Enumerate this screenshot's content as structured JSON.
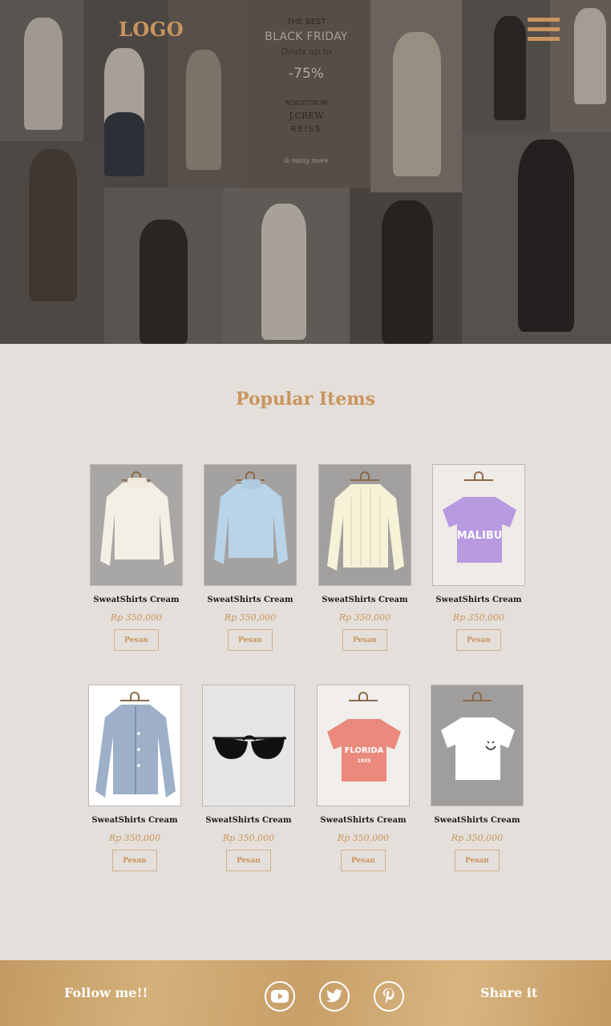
{
  "header": {
    "logo": "LOGO",
    "menu_icon": "hamburger-menu-icon"
  },
  "hero": {
    "promo": {
      "line1": "THE BEST",
      "line2": "BLACK FRIDAY",
      "line3": "Deals up to",
      "line4": "-75%",
      "line5": "NORDSTROM",
      "line6": "J.CREW",
      "line7": "REISS",
      "line8": "& many more"
    }
  },
  "popular": {
    "title": "Popular Items",
    "items": [
      {
        "name": "SweatShirts Cream",
        "price": "Rp 350,000",
        "button": "Pesan"
      },
      {
        "name": "SweatShirts Cream",
        "price": "Rp 350,000",
        "button": "Pesan"
      },
      {
        "name": "SweatShirts Cream",
        "price": "Rp 350,000",
        "button": "Pesan"
      },
      {
        "name": "SweatShirts Cream",
        "price": "Rp 350,000",
        "button": "Pesan"
      },
      {
        "name": "SweatShirts Cream",
        "price": "Rp 350,000",
        "button": "Pesan"
      },
      {
        "name": "SweatShirts Cream",
        "price": "Rp 350,000",
        "button": "Pesan"
      },
      {
        "name": "SweatShirts Cream",
        "price": "Rp 350,000",
        "button": "Pesan"
      },
      {
        "name": "SweatShirts Cream",
        "price": "Rp 350,000",
        "button": "Pesan"
      }
    ],
    "item_graphics": {
      "malibu_print": "MALIBU",
      "florida_print": "FLORIDA",
      "florida_sub": "1933"
    }
  },
  "footer": {
    "follow_label": "Follow me!!",
    "share_label": "Share it",
    "social_icons": [
      "youtube-icon",
      "twitter-icon",
      "pinterest-icon"
    ]
  },
  "colors": {
    "accent": "#c9955e",
    "page_bg": "#e4dfda",
    "footer_bg": "#c9a26b"
  }
}
